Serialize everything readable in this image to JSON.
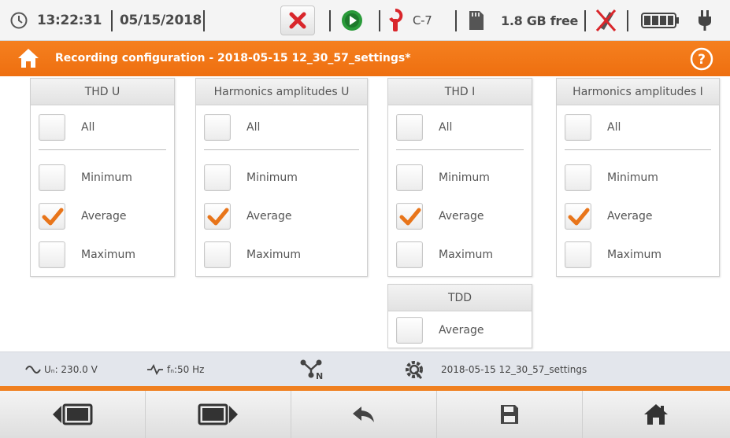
{
  "status": {
    "clock_icon": "clock-icon",
    "time": "13:22:31",
    "date": "05/15/2018",
    "stop_icon": "red-x-icon",
    "run_icon": "green-play-icon",
    "clamp_icon": "red-clamp-icon",
    "clamp_label": "C-7",
    "sd_icon": "sd-card-icon",
    "storage": "1.8 GB free",
    "no_gps_icon": "gps-off-icon",
    "battery_icon": "battery-icon",
    "plug_icon": "plug-icon"
  },
  "title": {
    "text": "Recording configuration - 2018-05-15 12_30_57_settings*",
    "home_icon": "home-icon",
    "help_icon": "help-icon",
    "color": "#f07818"
  },
  "panels": [
    {
      "header": "THD U",
      "all": {
        "label": "All",
        "checked": false
      },
      "options": [
        {
          "label": "Minimum",
          "checked": false
        },
        {
          "label": "Average",
          "checked": true
        },
        {
          "label": "Maximum",
          "checked": false
        }
      ]
    },
    {
      "header": "Harmonics amplitudes U",
      "all": {
        "label": "All",
        "checked": false
      },
      "options": [
        {
          "label": "Minimum",
          "checked": false
        },
        {
          "label": "Average",
          "checked": true
        },
        {
          "label": "Maximum",
          "checked": false
        }
      ]
    },
    {
      "header": "THD I",
      "all": {
        "label": "All",
        "checked": false
      },
      "options": [
        {
          "label": "Minimum",
          "checked": false
        },
        {
          "label": "Average",
          "checked": true
        },
        {
          "label": "Maximum",
          "checked": false
        }
      ]
    },
    {
      "header": "Harmonics amplitudes I",
      "all": {
        "label": "All",
        "checked": false
      },
      "options": [
        {
          "label": "Minimum",
          "checked": false
        },
        {
          "label": "Average",
          "checked": true
        },
        {
          "label": "Maximum",
          "checked": false
        }
      ]
    }
  ],
  "tdd": {
    "header": "TDD",
    "option": {
      "label": "Average",
      "checked": false
    }
  },
  "info": {
    "voltage_label": "Uₙ: 230.0 V",
    "freq_label": "fₙ:50 Hz",
    "network_icon": "network-type-icon",
    "settings_icon": "settings-gear-icon",
    "settings_name": "2018-05-15 12_30_57_settings"
  },
  "toolbar": {
    "buttons": [
      {
        "name": "prev-screen-button",
        "icon": "prev-screen-icon"
      },
      {
        "name": "next-screen-button",
        "icon": "next-screen-icon"
      },
      {
        "name": "back-button",
        "icon": "back-arrow-icon"
      },
      {
        "name": "save-button",
        "icon": "save-icon"
      },
      {
        "name": "home-button",
        "icon": "home-icon"
      }
    ]
  },
  "colors": {
    "accent": "#f07818",
    "check": "#e8751a",
    "stop_red": "#d9262b",
    "run_green": "#2a9b3a"
  }
}
